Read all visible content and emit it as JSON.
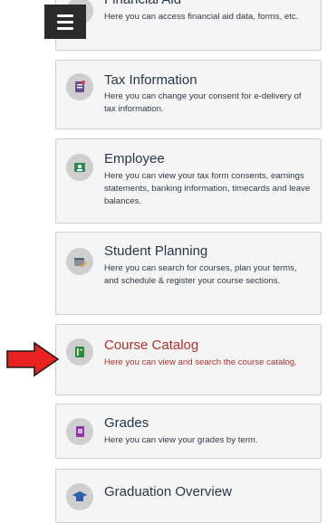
{
  "menu": {
    "icon": "hamburger-icon"
  },
  "cards": [
    {
      "title": "Financial Aid",
      "desc": "Here you can access financial aid data, forms, etc.",
      "icon": "financial-aid-icon"
    },
    {
      "title": "Tax Information",
      "desc": "Here you can change your consent for e-delivery of tax information.",
      "icon": "tax-document-icon"
    },
    {
      "title": "Employee",
      "desc": "Here you can view your tax form consents, earnings statements, banking information, timecards and leave balances.",
      "icon": "employee-badge-icon"
    },
    {
      "title": "Student Planning",
      "desc": "Here you can search for courses, plan your terms, and schedule & register your course sections.",
      "icon": "calendar-edit-icon"
    },
    {
      "title": "Course Catalog",
      "desc": "Here you can view and search the course catalog.",
      "icon": "catalog-book-icon"
    },
    {
      "title": "Grades",
      "desc": "Here you can view your grades by term.",
      "icon": "grades-book-icon"
    },
    {
      "title": "Graduation Overview",
      "desc": "",
      "icon": "graduation-cap-icon"
    }
  ],
  "annotation": {
    "icon": "red-arrow-icon"
  },
  "colors": {
    "highlight_text": "#b0312e",
    "title_text": "#26374a",
    "arrow": "#e8231f"
  }
}
